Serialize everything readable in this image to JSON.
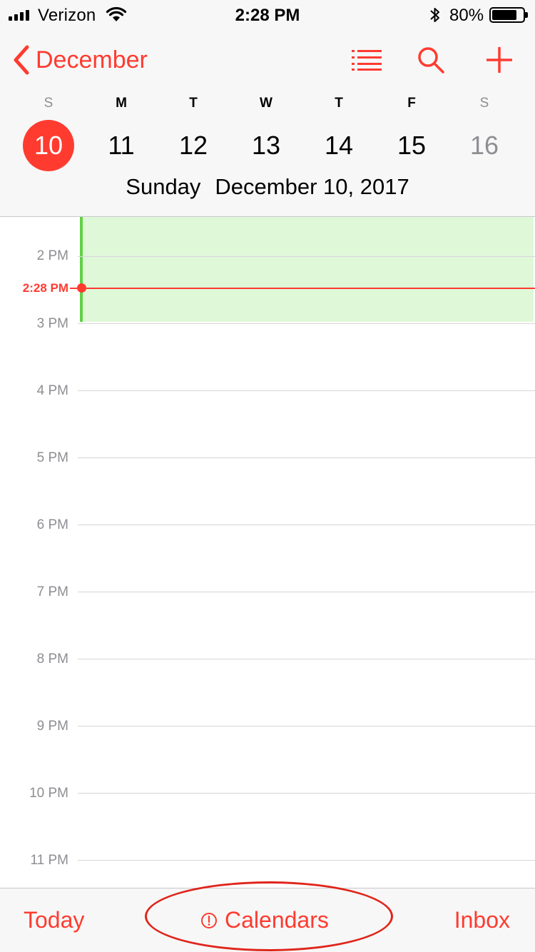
{
  "status_bar": {
    "carrier": "Verizon",
    "time": "2:28 PM",
    "battery_percent": "80%",
    "battery_level": 0.8
  },
  "nav": {
    "back_label": "December",
    "icons": [
      "list-icon",
      "search-icon",
      "add-icon"
    ]
  },
  "week": {
    "days": [
      {
        "letter": "S",
        "date": "10",
        "selected": true,
        "weekend": true
      },
      {
        "letter": "M",
        "date": "11",
        "selected": false,
        "weekend": false
      },
      {
        "letter": "T",
        "date": "12",
        "selected": false,
        "weekend": false
      },
      {
        "letter": "W",
        "date": "13",
        "selected": false,
        "weekend": false
      },
      {
        "letter": "T",
        "date": "14",
        "selected": false,
        "weekend": false
      },
      {
        "letter": "F",
        "date": "15",
        "selected": false,
        "weekend": false
      },
      {
        "letter": "S",
        "date": "16",
        "selected": false,
        "weekend": true
      }
    ],
    "selected_weekday": "Sunday",
    "selected_full_date": "December 10, 2017"
  },
  "timeline": {
    "hours": [
      "2 PM",
      "3 PM",
      "4 PM",
      "5 PM",
      "6 PM",
      "7 PM",
      "8 PM",
      "9 PM",
      "10 PM",
      "11 PM"
    ],
    "current_time_label": "2:28 PM"
  },
  "tab_bar": {
    "today": "Today",
    "calendars": "Calendars",
    "inbox": "Inbox"
  },
  "colors": {
    "accent": "#ff3b30",
    "event_fill": "#dff8d8",
    "event_border": "#62d046",
    "secondary_text": "#8e8e93"
  }
}
